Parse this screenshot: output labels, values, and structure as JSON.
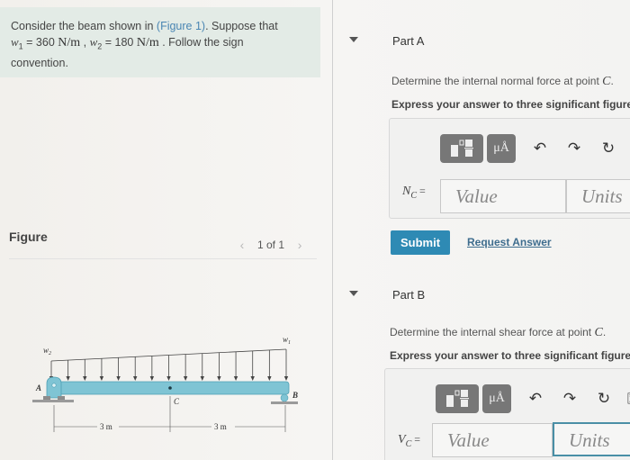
{
  "problem": {
    "intro": "Consider the beam shown in ",
    "figure_link": "(Figure 1)",
    "after_link": ". Suppose that",
    "w1_symbol": "w",
    "w1_sub": "1",
    "w1_eq": " = 360 ",
    "w1_unit": "N/m",
    "sep": " , ",
    "w2_symbol": "w",
    "w2_sub": "2",
    "w2_eq": " = 180 ",
    "w2_unit": "N/m",
    "tail": " . Follow the sign",
    "tail2": "convention."
  },
  "figure": {
    "heading": "Figure",
    "pager_text": "1 of 1",
    "prev_icon": "‹",
    "next_icon": "›",
    "labels": {
      "w2": "w",
      "w2_sub": "2",
      "w1": "w",
      "w1_sub": "1",
      "A": "A",
      "B": "B",
      "C": "C",
      "dim_left": "3 m",
      "dim_right": "3 m"
    },
    "colors": {
      "beam": "#7fc4d4",
      "beam_dark": "#4e9fb3",
      "support": "#8c8c8c"
    }
  },
  "partA": {
    "title": "Part A",
    "question": "Determine the internal normal force at point ",
    "point": "C",
    "question_end": ".",
    "instruction": "Express your answer to three significant figures",
    "var": "N",
    "var_sub": "C",
    "eq": " =",
    "value_placeholder": "Value",
    "units_placeholder": "Units",
    "units_btn": "μÅ",
    "undo_icon": "↶",
    "redo_icon": "↷",
    "reset_icon": "↻",
    "submit": "Submit",
    "request_answer": "Request Answer"
  },
  "partB": {
    "title": "Part B",
    "question": "Determine the internal shear force at point ",
    "point": "C",
    "question_end": ".",
    "instruction": "Express your answer to three significant figures",
    "var": "V",
    "var_sub": "C",
    "eq": " =",
    "value_placeholder": "Value",
    "units_placeholder": "Units",
    "units_btn": "μÅ",
    "undo_icon": "↶",
    "redo_icon": "↷",
    "reset_icon": "↻",
    "keyboard_icon": "⌨"
  },
  "colors": {
    "accent": "#2e8ab4",
    "link": "#3e6d8e",
    "problem_bg": "#e3ebe6"
  }
}
